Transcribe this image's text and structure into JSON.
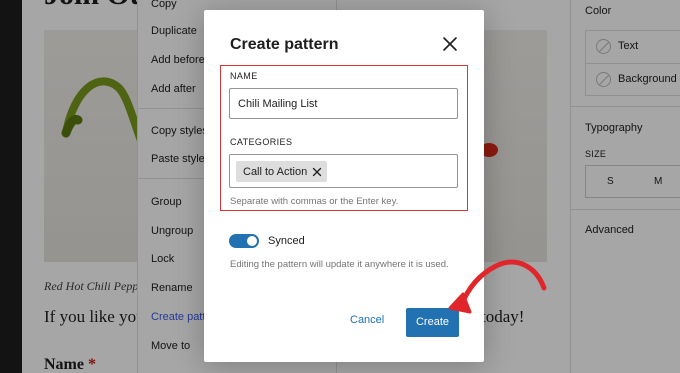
{
  "editor": {
    "heading": "Join Our",
    "caption": "Red Hot Chili Peppers",
    "paragraph_left": "If you like your",
    "paragraph_right": "today!",
    "field_label": "Name",
    "required_mark": "*"
  },
  "block_menu": {
    "items": [
      "Copy",
      "Duplicate",
      "Add before",
      "Add after",
      "Copy styles",
      "Paste styles",
      "Group",
      "Ungroup",
      "Lock",
      "Rename",
      "Create pattern",
      "Move to"
    ],
    "active_item": "Create pattern"
  },
  "sidebar": {
    "color_title": "Color",
    "color_options": [
      "Text",
      "Background"
    ],
    "typography_title": "Typography",
    "size_label": "SIZE",
    "size_options": [
      "S",
      "M"
    ],
    "advanced_title": "Advanced"
  },
  "modal": {
    "title": "Create pattern",
    "close_icon": "close-icon",
    "name_label": "NAME",
    "name_value": "Chili Mailing List",
    "categories_label": "CATEGORIES",
    "category_token": "Call to Action",
    "categories_help": "Separate with commas or the Enter key.",
    "synced_label": "Synced",
    "synced_on": true,
    "synced_help": "Editing the pattern will update it anywhere it is used.",
    "cancel_label": "Cancel",
    "create_label": "Create"
  },
  "colors": {
    "accent": "#2271b1",
    "highlight_box": "#d63638",
    "annotation_arrow": "#e0262b"
  }
}
